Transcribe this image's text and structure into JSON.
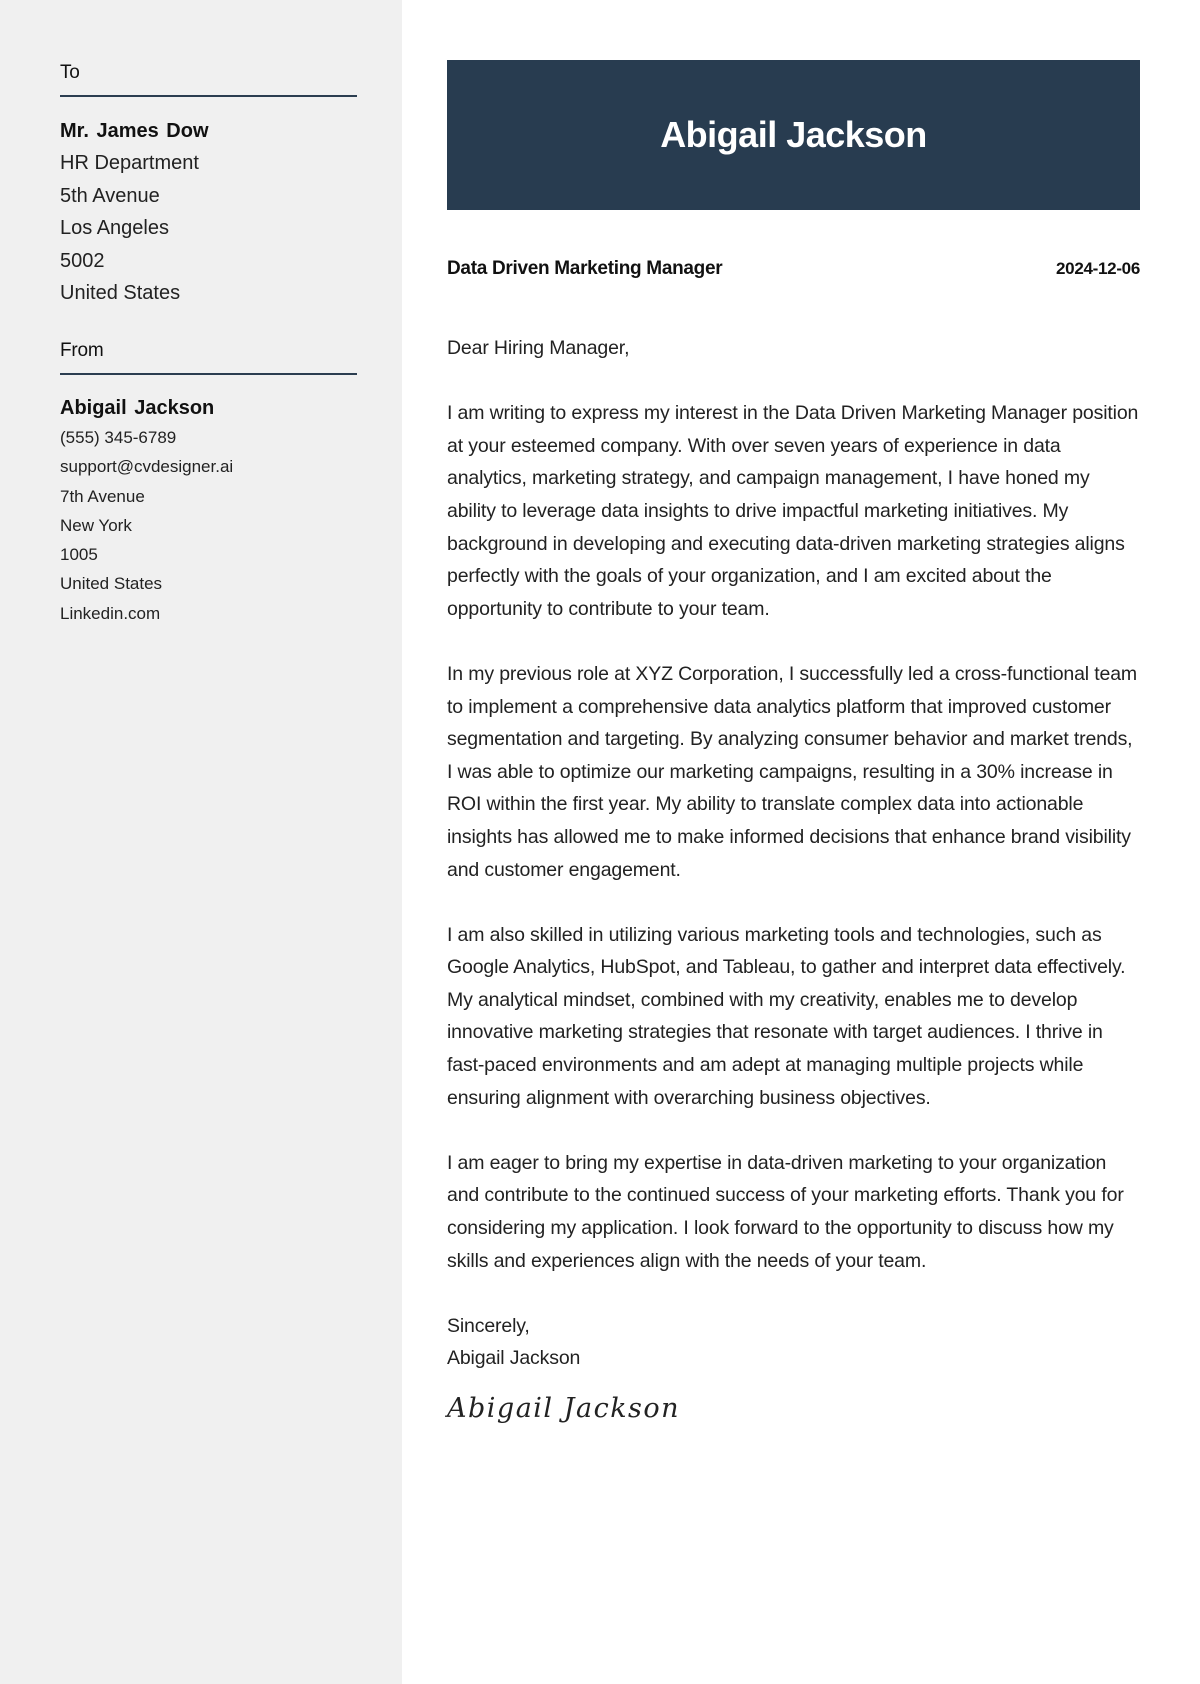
{
  "sidebar": {
    "to": {
      "heading": "To",
      "name": "Mr. James Dow",
      "lines": [
        "HR Department",
        "5th Avenue",
        "Los Angeles",
        "5002",
        "United States"
      ]
    },
    "from": {
      "heading": "From",
      "name": "Abigail Jackson",
      "lines": [
        "(555) 345-6789",
        "support@cvdesigner.ai",
        "7th Avenue",
        "New York",
        "1005",
        "United States",
        "Linkedin.com"
      ]
    }
  },
  "header": {
    "name": "Abigail Jackson",
    "background_color": "#283c50"
  },
  "meta": {
    "job_title": "Data Driven Marketing Manager",
    "date": "2024-12-06"
  },
  "letter": {
    "salutation": "Dear Hiring Manager,",
    "paragraphs": [
      "I am writing to express my interest in the Data Driven Marketing Manager position at your esteemed company. With over seven years of experience in data analytics, marketing strategy, and campaign management, I have honed my ability to leverage data insights to drive impactful marketing initiatives. My background in developing and executing data-driven marketing strategies aligns perfectly with the goals of your organization, and I am excited about the opportunity to contribute to your team.",
      "In my previous role at XYZ Corporation, I successfully led a cross-functional team to implement a comprehensive data analytics platform that improved customer segmentation and targeting. By analyzing consumer behavior and market trends, I was able to optimize our marketing campaigns, resulting in a 30% increase in ROI within the first year. My ability to translate complex data into actionable insights has allowed me to make informed decisions that enhance brand visibility and customer engagement.",
      "I am also skilled in utilizing various marketing tools and technologies, such as Google Analytics, HubSpot, and Tableau, to gather and interpret data effectively. My analytical mindset, combined with my creativity, enables me to develop innovative marketing strategies that resonate with target audiences. I thrive in fast-paced environments and am adept at managing multiple projects while ensuring alignment with overarching business objectives.",
      "I am eager to bring my expertise in data-driven marketing to your organization and contribute to the continued success of your marketing efforts. Thank you for considering my application. I look forward to the opportunity to discuss how my skills and experiences align with the needs of your team."
    ],
    "closing": "Sincerely,",
    "closing_name": "Abigail Jackson",
    "signature": "Abigail Jackson"
  }
}
